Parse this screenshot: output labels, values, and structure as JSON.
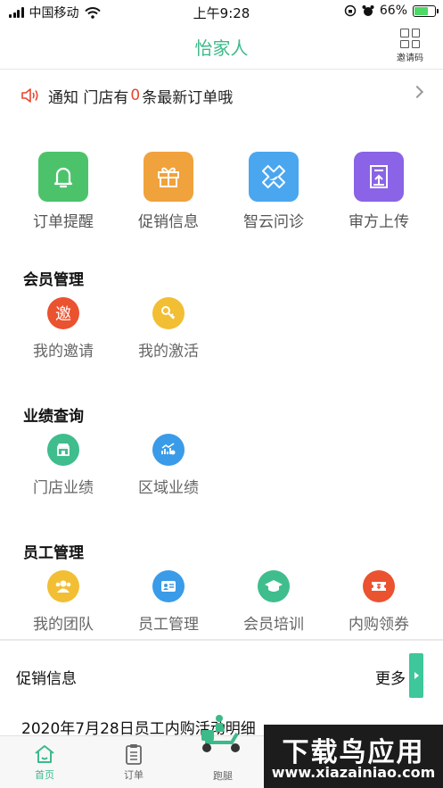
{
  "status_bar": {
    "carrier": "中国移动",
    "time": "上午9:28",
    "battery": "66%",
    "battery_level": 0.66
  },
  "navbar": {
    "title": "怡家人",
    "invite_code_label": "邀请码"
  },
  "notice": {
    "prefix": "通知 门店有",
    "count": "0",
    "suffix": "条最新订单哦"
  },
  "main_grid": [
    {
      "label": "订单提醒",
      "icon": "bell-icon",
      "color": "#4cc36b"
    },
    {
      "label": "促销信息",
      "icon": "gift-icon",
      "color": "#f0a23c"
    },
    {
      "label": "智云问诊",
      "icon": "consult-icon",
      "color": "#4aa6ef"
    },
    {
      "label": "审方上传",
      "icon": "upload-icon",
      "color": "#8a63e6"
    }
  ],
  "member_mgmt": {
    "title": "会员管理",
    "items": [
      {
        "label": "我的邀请",
        "icon_text": "邀",
        "color": "#ea5230"
      },
      {
        "label": "我的激活",
        "icon": "key-icon",
        "color": "#f2be33"
      }
    ]
  },
  "performance": {
    "title": "业绩查询",
    "items": [
      {
        "label": "门店业绩",
        "icon": "store-icon",
        "color": "#3fbd8d"
      },
      {
        "label": "区域业绩",
        "icon": "chart-icon",
        "color": "#3a9be8"
      }
    ]
  },
  "staff_mgmt": {
    "title": "员工管理",
    "items": [
      {
        "label": "我的团队",
        "icon": "team-icon",
        "color": "#f2be33"
      },
      {
        "label": "员工管理",
        "icon": "id-card-icon",
        "color": "#3a9be8"
      },
      {
        "label": "会员培训",
        "icon": "graduation-icon",
        "color": "#3fbd8d"
      },
      {
        "label": "内购领券",
        "icon": "ticket-icon",
        "color": "#ea5230"
      }
    ]
  },
  "promo": {
    "title": "促销信息",
    "more": "更多",
    "first_item": "2020年7月28日员工内购活动明细"
  },
  "tabbar": [
    {
      "label": "首页",
      "icon": "home-icon",
      "active": true
    },
    {
      "label": "订单",
      "icon": "clipboard-icon",
      "active": false
    },
    {
      "label": "跑腿",
      "icon": "scooter-icon",
      "active": false
    }
  ],
  "watermark": {
    "title": "下载鸟应用",
    "sub": "www.xiazainiao.com"
  },
  "colors": {
    "accent": "#3dba8a",
    "alert": "#e8452f"
  }
}
